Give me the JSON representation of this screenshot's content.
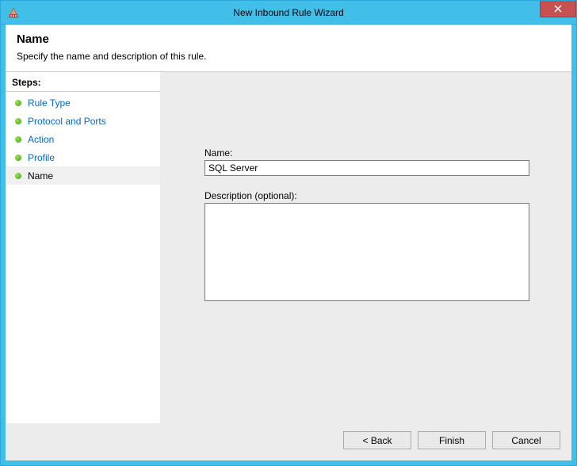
{
  "window": {
    "title": "New Inbound Rule Wizard"
  },
  "header": {
    "title": "Name",
    "subtitle": "Specify the name and description of this rule."
  },
  "sidebar": {
    "title": "Steps:",
    "items": [
      {
        "label": "Rule Type",
        "current": false
      },
      {
        "label": "Protocol and Ports",
        "current": false
      },
      {
        "label": "Action",
        "current": false
      },
      {
        "label": "Profile",
        "current": false
      },
      {
        "label": "Name",
        "current": true
      }
    ]
  },
  "form": {
    "name_label": "Name:",
    "name_value": "SQL Server",
    "desc_label": "Description (optional):",
    "desc_value": ""
  },
  "buttons": {
    "back": "< Back",
    "finish": "Finish",
    "cancel": "Cancel"
  }
}
